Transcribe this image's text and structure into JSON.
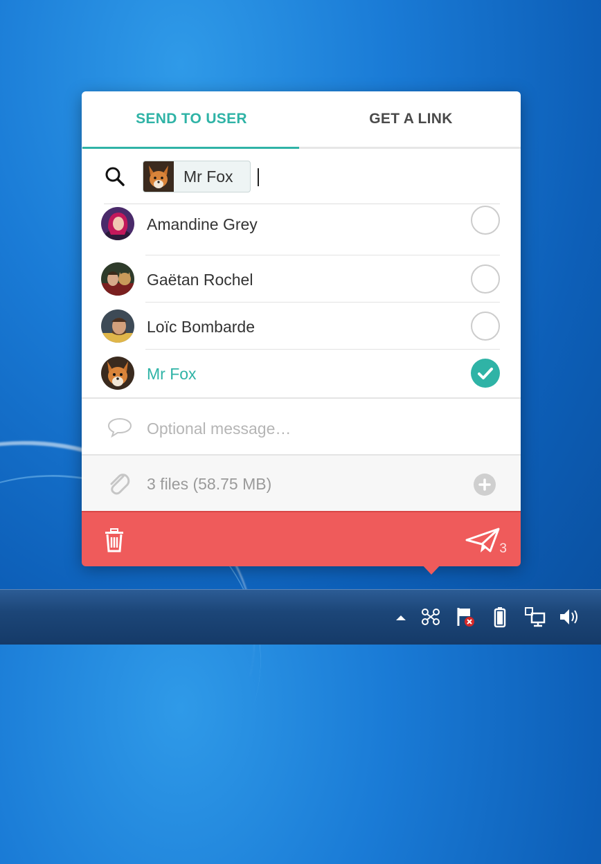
{
  "tabs": [
    {
      "label": "SEND TO USER",
      "active": true
    },
    {
      "label": "GET A LINK",
      "active": false
    }
  ],
  "search": {
    "chip_label": "Mr Fox",
    "icon": "search-icon"
  },
  "contacts": [
    {
      "name": "Amandine Grey",
      "selected": false,
      "avatar": "avatar-amandine"
    },
    {
      "name": "Gaëtan Rochel",
      "selected": false,
      "avatar": "avatar-gaetan"
    },
    {
      "name": "Loïc Bombarde",
      "selected": false,
      "avatar": "avatar-loic"
    },
    {
      "name": "Mr Fox",
      "selected": true,
      "avatar": "avatar-mrfox"
    }
  ],
  "message": {
    "placeholder": "Optional message…",
    "icon": "speech-bubble-icon"
  },
  "files": {
    "label": "3 files (58.75 MB)",
    "icon": "paperclip-icon",
    "add_icon": "plus-circle-icon"
  },
  "actions": {
    "delete_icon": "trash-icon",
    "send_icon": "paper-plane-icon",
    "send_count": "3"
  },
  "colors": {
    "accent": "#2fb3a6",
    "action_bar": "#ef5b5b"
  },
  "taskbar": {
    "tray_icons": [
      "show-hidden-icons-chevron",
      "app-tray-icon",
      "action-center-flag-icon",
      "battery-icon",
      "network-icon",
      "volume-icon"
    ]
  }
}
